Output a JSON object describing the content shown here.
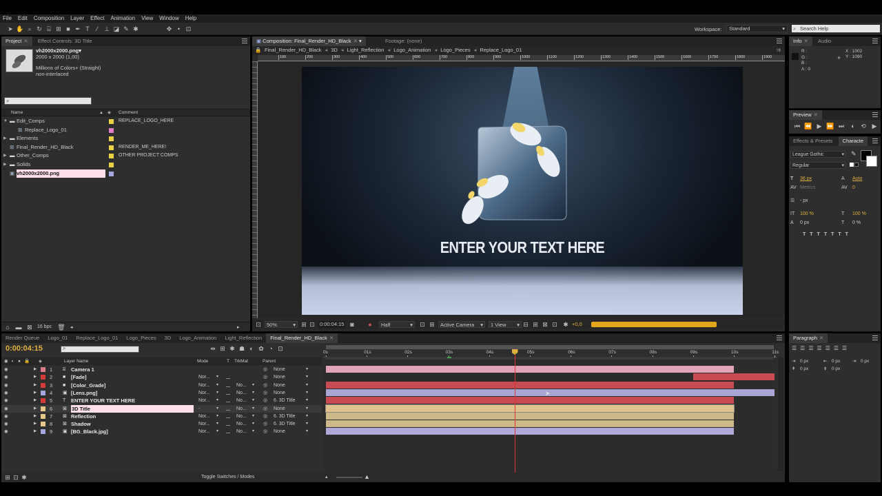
{
  "menu": [
    "File",
    "Edit",
    "Composition",
    "Layer",
    "Effect",
    "Animation",
    "View",
    "Window",
    "Help"
  ],
  "toolbar": {
    "workspace_label": "Workspace:",
    "workspace_value": "Standard",
    "search_placeholder": "Search Help"
  },
  "project": {
    "tab_project": "Project",
    "tab_effect_controls": "Effect Controls: 3D Title",
    "file_name": "vh2000x2000.png",
    "file_usage": "▾",
    "info_lines": [
      "2000 x 2000 (1,00)",
      "",
      "Millions of Colors+ (Straight)",
      "non-interlaced"
    ],
    "col_name": "Name",
    "col_comment": "Comment",
    "items": [
      {
        "name": "Edit_Comps",
        "comment": "REPLACE_LOGO_HERE",
        "color": "#e8d244",
        "type": "folder",
        "indent": 0,
        "open": true
      },
      {
        "name": "Replace_Logo_01",
        "comment": "",
        "color": "#e07bc8",
        "type": "comp",
        "indent": 1
      },
      {
        "name": "Elements",
        "comment": "",
        "color": "#e8d244",
        "type": "folder",
        "indent": 0
      },
      {
        "name": "Final_Render_HD_Black",
        "comment": "RENDER_ME_HERE!",
        "color": "#e8d244",
        "type": "comp",
        "indent": 0
      },
      {
        "name": "Other_Comps",
        "comment": "OTHER PROJECT COMPS",
        "color": "#e8d244",
        "type": "folder",
        "indent": 0
      },
      {
        "name": "Solids",
        "comment": "",
        "color": "#e8d244",
        "type": "folder",
        "indent": 0
      },
      {
        "name": "vh2000x2000.png",
        "comment": "",
        "color": "#a6a6e0",
        "type": "image",
        "indent": 0,
        "selected": true
      }
    ],
    "bpc": "16 bpc"
  },
  "composition": {
    "tab_label": "Composition: Final_Render_HD_Black",
    "footage_tab": "Footage: (none)",
    "breadcrumbs": [
      "Final_Render_HD_Black",
      "3D",
      "Light_Reflection",
      "Logo_Animation",
      "Logo_Pieces",
      "Replace_Logo_01"
    ],
    "ruler_ticks": [
      "100",
      "200",
      "300",
      "400",
      "500",
      "600",
      "700",
      "800",
      "900",
      "1000",
      "1100",
      "1200",
      "1300",
      "1400",
      "1500",
      "1600",
      "1750",
      "1800",
      "1900"
    ],
    "overlay_text": "ENTER YOUR TEXT HERE",
    "zoom": "50%",
    "timecode": "0:00:04:15",
    "resolution": "Half",
    "camera": "Active Camera",
    "views": "1 View",
    "exposure": "+0,0"
  },
  "info": {
    "tab_info": "Info",
    "tab_audio": "Audio",
    "r": "R :",
    "g": "G :",
    "b": "B :",
    "a": "A : 0",
    "x": "X : 1002",
    "y": "Y : 1090"
  },
  "preview": {
    "tab": "Preview"
  },
  "character": {
    "tab_effects": "Effects & Presets",
    "tab_character": "Characte",
    "font": "League Gothic",
    "style": "Regular",
    "size": "36 px",
    "leading": "Auto",
    "kerning": "Metrics",
    "tracking": "0",
    "stroke": "- px",
    "vscale": "100 %",
    "hscale": "100 %",
    "baseline": "0 px",
    "tsume": "0 %"
  },
  "paragraph": {
    "tab": "Paragraph",
    "indent1": "0 px",
    "indent2": "0 px",
    "indent3": "0 px",
    "space1": "0 px",
    "space2": "0 px"
  },
  "timeline": {
    "tabs": [
      "Render Queue",
      "Logo_01",
      "Replace_Logo_01",
      "Logo_Pieces",
      "3D",
      "Logo_Animation",
      "Light_Reflection",
      "Final_Render_HD_Black"
    ],
    "timecode": "0:00:04:15",
    "col_layer_name": "Layer Name",
    "col_mode": "Mode",
    "col_t": "T",
    "col_trkmat": "TrkMat",
    "col_parent": "Parent",
    "time_ticks": [
      "0s",
      "01s",
      "02s",
      "03s",
      "04s",
      "05s",
      "06s",
      "07s",
      "08s",
      "09s",
      "10s",
      "11s"
    ],
    "layers": [
      {
        "num": "1",
        "name": "Camera 1",
        "color": "#e07b8a",
        "mode": "",
        "trkmat": "",
        "parent": "None",
        "bar_color": "#e3a3b8",
        "start": 0,
        "end": 10,
        "icon": "camera"
      },
      {
        "num": "2",
        "name": "[Fade]",
        "color": "#d83a3a",
        "mode": "Nor...",
        "trkmat": "",
        "parent": "None",
        "bar_color": "#c84a52",
        "start": 9,
        "end": 11,
        "icon": "solid"
      },
      {
        "num": "3",
        "name": "[Color_Grade]",
        "color": "#d83a3a",
        "mode": "Nor...",
        "trkmat": "No...",
        "parent": "None",
        "bar_color": "#c84a52",
        "start": 0,
        "end": 10,
        "icon": "solid"
      },
      {
        "num": "4",
        "name": "[Lens.png]",
        "color": "#a6a6e0",
        "mode": "Nor...",
        "trkmat": "No...",
        "parent": "None",
        "bar_color": "#a9a6d6",
        "start": 0,
        "end": 11,
        "icon": "image"
      },
      {
        "num": "5",
        "name": "ENTER YOUR TEXT HERE",
        "color": "#d83a3a",
        "mode": "Nor...",
        "trkmat": "No...",
        "parent": "6. 3D Title",
        "bar_color": "#c84a52",
        "start": 0,
        "end": 10,
        "icon": "text"
      },
      {
        "num": "6",
        "name": "3D Title",
        "color": "#e8c88a",
        "mode": "-",
        "trkmat": "No...",
        "parent": "None",
        "bar_color": "#e2c28c",
        "start": 0,
        "end": 10,
        "icon": "comp",
        "selected": true
      },
      {
        "num": "7",
        "name": "Reflection",
        "color": "#e8c88a",
        "mode": "Nor...",
        "trkmat": "No...",
        "parent": "6. 3D Title",
        "bar_color": "#cdb889",
        "start": 0,
        "end": 10,
        "icon": "comp"
      },
      {
        "num": "8",
        "name": "Shadow",
        "color": "#e8c88a",
        "mode": "Nor...",
        "trkmat": "No...",
        "parent": "6. 3D Title",
        "bar_color": "#cdb889",
        "start": 0,
        "end": 10,
        "icon": "comp"
      },
      {
        "num": "9",
        "name": "[BG_Black.jpg]",
        "color": "#a6a6e0",
        "mode": "Nor...",
        "trkmat": "No...",
        "parent": "None",
        "bar_color": "#b0a8d8",
        "start": 0,
        "end": 10,
        "icon": "image"
      }
    ],
    "toggle_label": "Toggle Switches / Modes",
    "current_time_seconds": 4.62
  }
}
